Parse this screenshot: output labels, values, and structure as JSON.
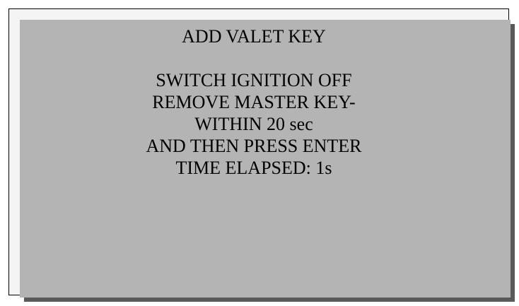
{
  "screen": {
    "title": "ADD VALET KEY",
    "instructions": [
      "SWITCH IGNITION OFF",
      "REMOVE MASTER KEY-",
      "WITHIN 20 sec",
      "AND THEN PRESS ENTER"
    ],
    "status": "TIME ELAPSED: 1s"
  },
  "colors": {
    "panel": "#b4b4b4",
    "shadow": "#5a5a5a",
    "frame_background": "#f4f4f4",
    "border": "#000000",
    "text": "#000000"
  }
}
